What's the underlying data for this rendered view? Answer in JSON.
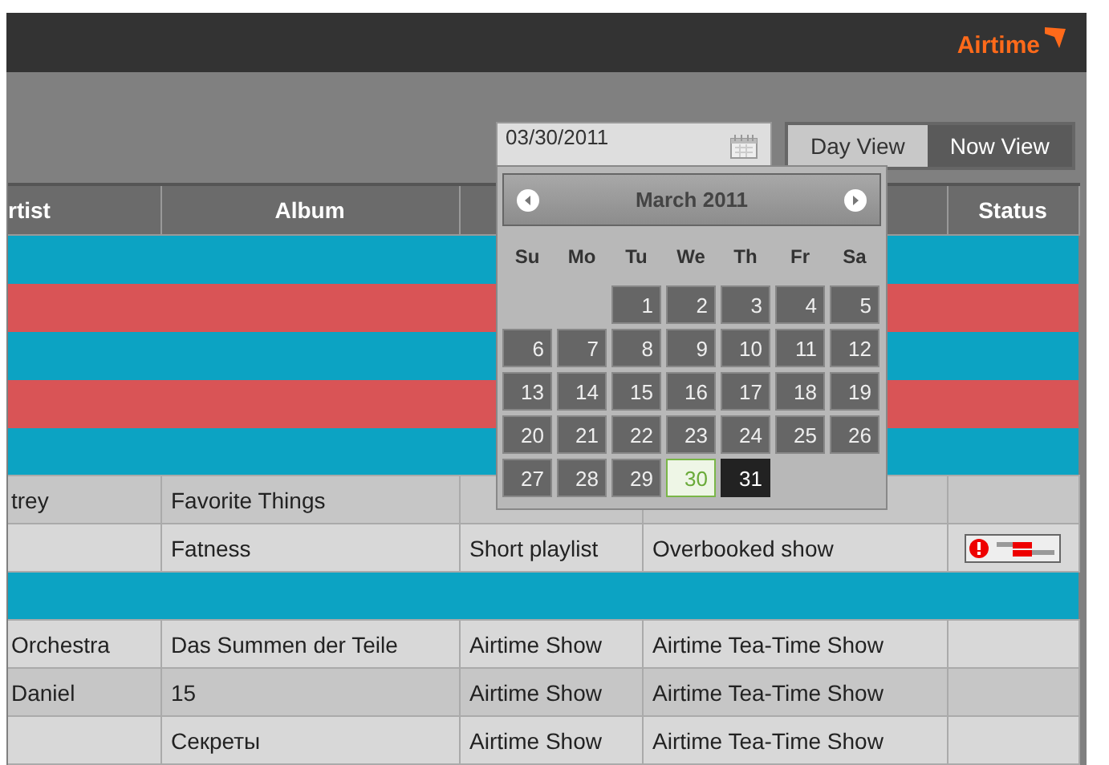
{
  "header": {
    "logo": "Airtime"
  },
  "toolbar": {
    "date_field": {
      "value": "03/30/2011"
    },
    "view_buttons": [
      {
        "label": "Day View",
        "selected": true
      },
      {
        "label": "Now View",
        "selected": false
      }
    ]
  },
  "datepicker": {
    "month": "March 2011",
    "weekdays": [
      "Su",
      "Mo",
      "Tu",
      "We",
      "Th",
      "Fr",
      "Sa"
    ],
    "weeks": [
      [
        {
          "day": "1",
          "today": false,
          "selected": false
        },
        {
          "day": "2",
          "today": false,
          "selected": false
        },
        {
          "day": "3",
          "today": false,
          "selected": false
        },
        {
          "day": "4",
          "today": false,
          "selected": false
        },
        {
          "day": "5",
          "today": false,
          "selected": false
        }
      ],
      [
        {
          "day": "6",
          "today": false,
          "selected": false
        },
        {
          "day": "7",
          "today": false,
          "selected": false
        },
        {
          "day": "8",
          "today": false,
          "selected": false
        },
        {
          "day": "9",
          "today": false,
          "selected": false
        },
        {
          "day": "10",
          "today": false,
          "selected": false
        },
        {
          "day": "11",
          "today": false,
          "selected": false
        },
        {
          "day": "12",
          "today": false,
          "selected": false
        }
      ],
      [
        {
          "day": "13",
          "today": false,
          "selected": false
        },
        {
          "day": "14",
          "today": false,
          "selected": false
        },
        {
          "day": "15",
          "today": false,
          "selected": false
        },
        {
          "day": "16",
          "today": false,
          "selected": false
        },
        {
          "day": "17",
          "today": false,
          "selected": false
        },
        {
          "day": "18",
          "today": false,
          "selected": false
        },
        {
          "day": "19",
          "today": false,
          "selected": false
        }
      ],
      [
        {
          "day": "20",
          "today": false,
          "selected": false
        },
        {
          "day": "21",
          "today": false,
          "selected": false
        },
        {
          "day": "22",
          "today": false,
          "selected": false
        },
        {
          "day": "23",
          "today": false,
          "selected": false
        },
        {
          "day": "24",
          "today": false,
          "selected": false
        },
        {
          "day": "25",
          "today": false,
          "selected": false
        },
        {
          "day": "26",
          "today": false,
          "selected": false
        }
      ],
      [
        {
          "day": "27",
          "today": false,
          "selected": false
        },
        {
          "day": "28",
          "today": false,
          "selected": false
        },
        {
          "day": "29",
          "today": false,
          "selected": false
        },
        {
          "day": "30",
          "today": true,
          "selected": false
        },
        {
          "day": "31",
          "today": false,
          "selected": true
        }
      ]
    ]
  },
  "table": {
    "columns": [
      "rtist",
      "Album",
      "",
      "",
      "Status"
    ],
    "rows": [
      {
        "kind": "band",
        "color": "#0ca3c3"
      },
      {
        "kind": "band",
        "color": "#d95456"
      },
      {
        "kind": "band",
        "color": "#0ca3c3"
      },
      {
        "kind": "band",
        "color": "#d95456"
      },
      {
        "kind": "band",
        "color": "#0ca3c3"
      },
      {
        "kind": "track",
        "artist": "trey",
        "album": "Favorite Things",
        "warning": false
      },
      {
        "kind": "track",
        "album": "Fatness",
        "column_3": "Short playlist",
        "column_4": "Overbooked show",
        "warning": true
      },
      {
        "kind": "band",
        "color": "#0ca3c3"
      },
      {
        "kind": "track",
        "artist": "Orchestra",
        "album": "Das Summen der Teile",
        "column_3": "Airtime Show",
        "column_4": "Airtime Tea-Time Show",
        "warning": false
      },
      {
        "kind": "track",
        "artist": "Daniel",
        "album": "15",
        "column_3": "Airtime Show",
        "column_4": "Airtime Tea-Time Show",
        "warning": false
      },
      {
        "kind": "track",
        "album": "Секреты",
        "column_3": "Airtime Show",
        "column_4": "Airtime Tea-Time Show",
        "warning": false
      }
    ]
  }
}
